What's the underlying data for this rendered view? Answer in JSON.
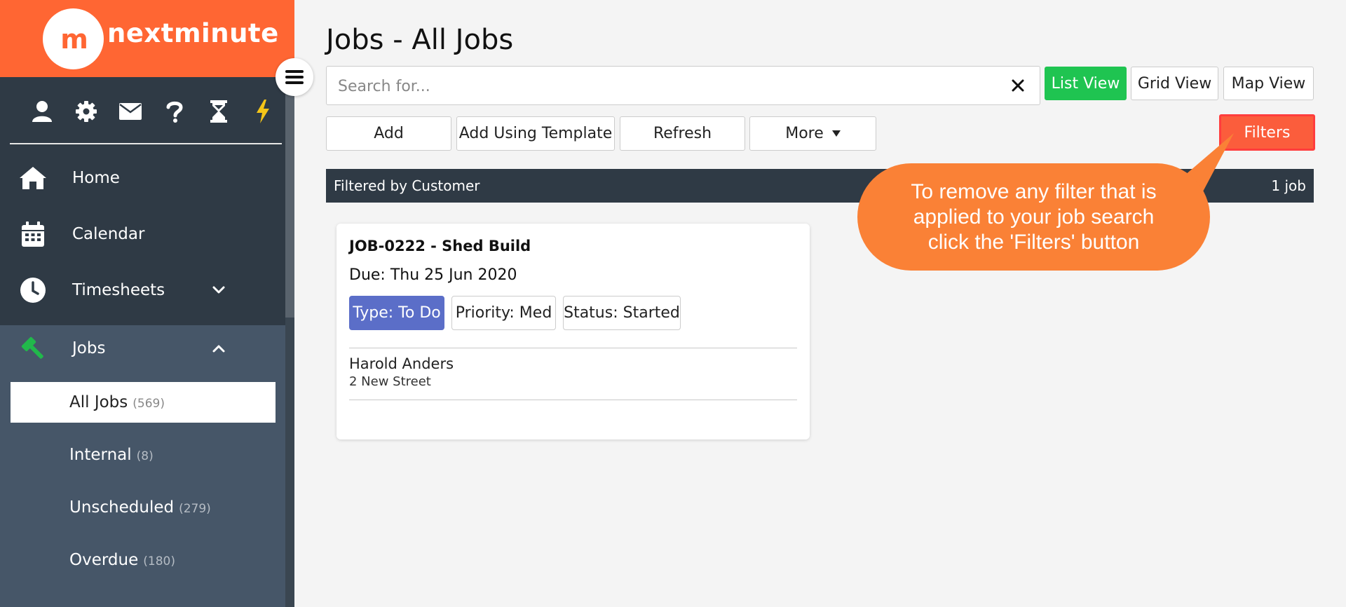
{
  "brand": {
    "logo_mark": "m",
    "name": "nextminute",
    "color": "#ff6633"
  },
  "icon_bar": [
    {
      "icon": "user-icon"
    },
    {
      "icon": "gear-icon"
    },
    {
      "icon": "envelope-icon"
    },
    {
      "icon": "question-icon"
    },
    {
      "icon": "hourglass-icon"
    },
    {
      "icon": "lightning-icon"
    }
  ],
  "nav": {
    "home": "Home",
    "calendar": "Calendar",
    "timesheets": "Timesheets",
    "jobs": "Jobs"
  },
  "jobs_menu": [
    {
      "label": "All Jobs",
      "count": "(569)"
    },
    {
      "label": "Internal",
      "count": "(8)"
    },
    {
      "label": "Unscheduled",
      "count": "(279)"
    },
    {
      "label": "Overdue",
      "count": "(180)"
    }
  ],
  "page": {
    "title": "Jobs - All Jobs"
  },
  "search": {
    "placeholder": "Search for...",
    "value": ""
  },
  "views": {
    "list": "List View",
    "grid": "Grid View",
    "map": "Map View"
  },
  "toolbar": {
    "add": "Add",
    "add_template": "Add Using Template",
    "refresh": "Refresh",
    "more": "More",
    "filters": "Filters"
  },
  "filter_bar": {
    "label": "Filtered by Customer",
    "count": "1 job"
  },
  "job_card": {
    "title": "JOB-0222 - Shed Build",
    "due": "Due: Thu 25 Jun 2020",
    "type": "Type: To Do",
    "priority": "Priority: Med",
    "status": "Status: Started",
    "customer": "Harold Anders",
    "address": "2 New Street"
  },
  "callout": {
    "text": "To remove any filter that is applied to your job search click the 'Filters' button"
  },
  "colors": {
    "sidebar": "#2f3a45",
    "jobs_section": "#465668",
    "green": "#1fc451",
    "filters_button": "#fb5d3c",
    "type_badge": "#5b6ec8",
    "callout": "#fa8136",
    "jobs_icon": "#21b84b",
    "lightning": "#f5c518"
  }
}
